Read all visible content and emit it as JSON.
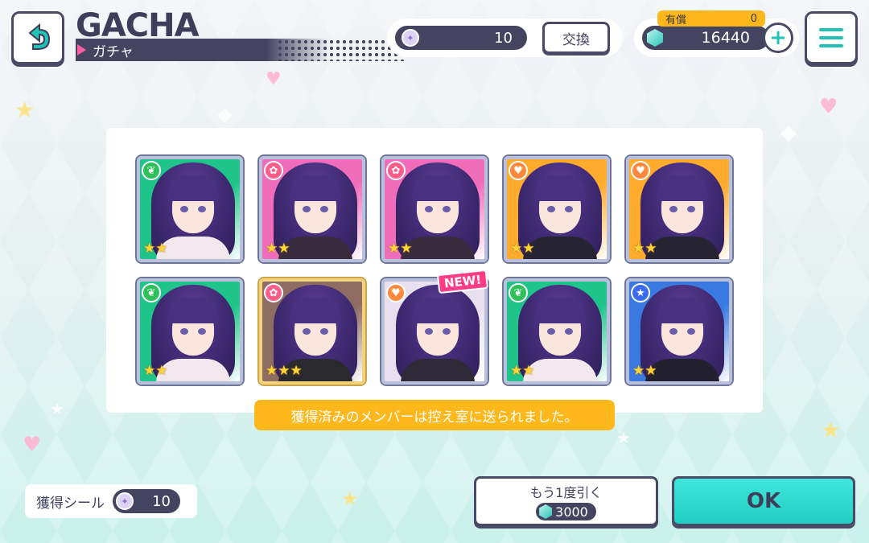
{
  "header": {
    "title_en": "GACHA",
    "title_jp": "ガチャ"
  },
  "currency": {
    "seal_count": "10",
    "exchange_label": "交換",
    "paid_label": "有償",
    "paid_count": "0",
    "crystal_count": "16440",
    "plus_label": "+"
  },
  "results": {
    "cards": [
      {
        "attribute": "leaf",
        "attr_color": "#2fbf5a",
        "bg": "#1fc48a",
        "outfit": "#f4e8ef",
        "stars": 2,
        "frame": "silver",
        "new": false
      },
      {
        "attribute": "flower",
        "attr_color": "#ff5d8a",
        "bg": "#f06dbb",
        "outfit": "#3a2c3f",
        "stars": 2,
        "frame": "silver",
        "new": false
      },
      {
        "attribute": "flower",
        "attr_color": "#ff5d8a",
        "bg": "#f06dbb",
        "outfit": "#3a2c3f",
        "stars": 2,
        "frame": "silver",
        "new": false
      },
      {
        "attribute": "heart",
        "attr_color": "#ff8a3d",
        "bg": "#ffab2e",
        "outfit": "#262433",
        "stars": 2,
        "frame": "silver",
        "new": false
      },
      {
        "attribute": "heart",
        "attr_color": "#ff8a3d",
        "bg": "#ffab2e",
        "outfit": "#262433",
        "stars": 2,
        "frame": "silver",
        "new": false
      },
      {
        "attribute": "leaf",
        "attr_color": "#2fbf5a",
        "bg": "#1fc48a",
        "outfit": "#f4e8ef",
        "stars": 2,
        "frame": "silver",
        "new": false
      },
      {
        "attribute": "flower",
        "attr_color": "#ff5d8a",
        "bg": "#8e6c62",
        "outfit": "#2a2a2e",
        "stars": 3,
        "frame": "gold",
        "new": false
      },
      {
        "attribute": "heart",
        "attr_color": "#ff8a3d",
        "bg": "#e8e0ef",
        "outfit": "#2e2a38",
        "stars": 0,
        "frame": "silver",
        "new": true
      },
      {
        "attribute": "leaf",
        "attr_color": "#2fbf5a",
        "bg": "#1fc48a",
        "outfit": "#f4e8ef",
        "stars": 2,
        "frame": "silver",
        "new": false
      },
      {
        "attribute": "star",
        "attr_color": "#3a6bf0",
        "bg": "#3a7ae0",
        "outfit": "#232030",
        "stars": 2,
        "frame": "silver",
        "new": false
      }
    ],
    "new_label": "NEW!",
    "notice": "獲得済みのメンバーは控え室に送られました。"
  },
  "footer": {
    "seal_gain_label": "獲得シール",
    "seal_gain_count": "10",
    "again_label": "もう1度引く",
    "again_cost": "3000",
    "ok_label": "OK"
  }
}
